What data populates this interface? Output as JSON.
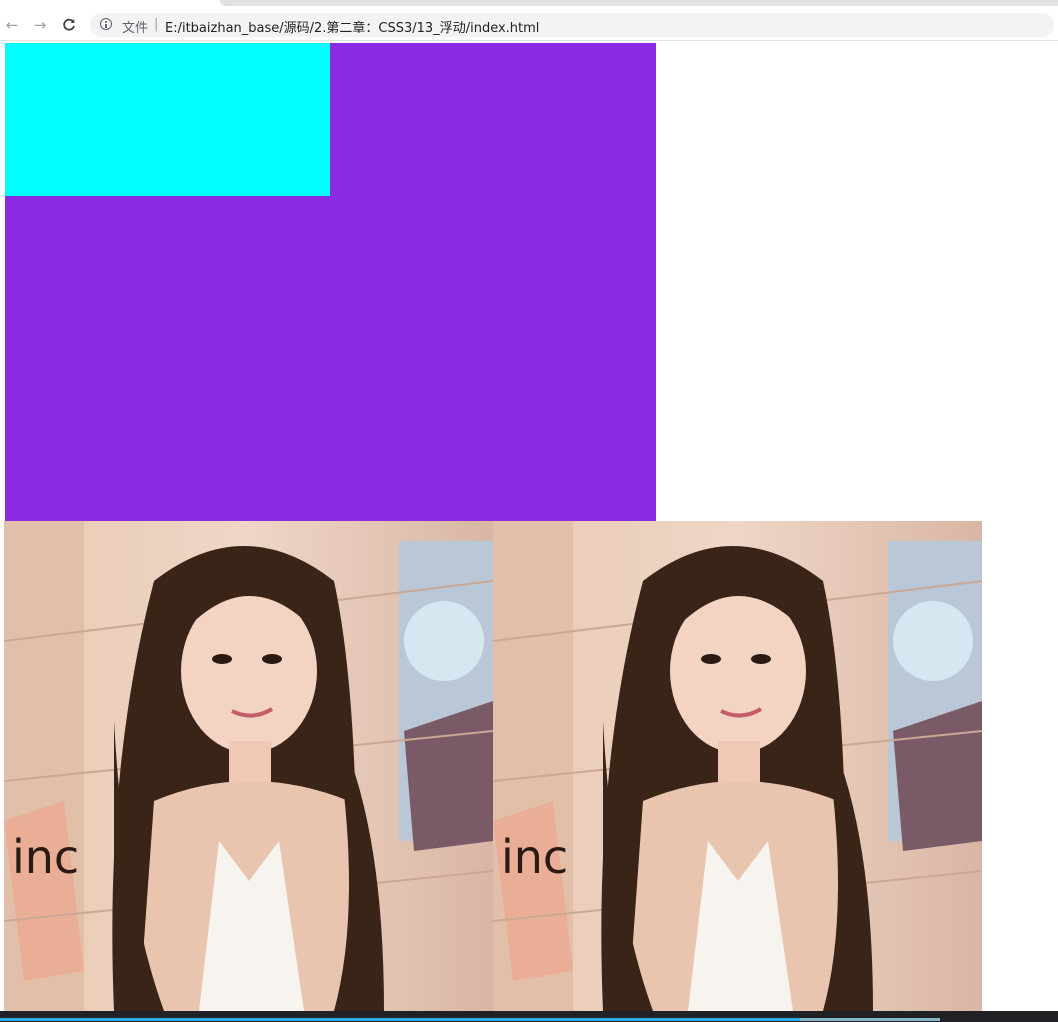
{
  "browser": {
    "nav": {
      "back_icon": "←",
      "forward_icon": "→",
      "reload_icon": "C"
    },
    "address_bar": {
      "security_label": "文件",
      "separator": "|",
      "url": "E:/itbaizhan_base/源码/2.第二章：CSS3/13_浮动/index.html"
    }
  },
  "page": {
    "boxes": [
      {
        "name": "purple-box",
        "color": "#8a2be2"
      },
      {
        "name": "cyan-box",
        "color": "#00ffff"
      }
    ],
    "images": [
      {
        "name": "photo-1",
        "description_icon": "portrait-photo",
        "wall_text": "inc"
      },
      {
        "name": "photo-2",
        "description_icon": "portrait-photo",
        "wall_text": "inc"
      }
    ]
  },
  "colors": {
    "purple": "#8a2be2",
    "cyan": "#00ffff",
    "progress": "#2ea8e6"
  }
}
